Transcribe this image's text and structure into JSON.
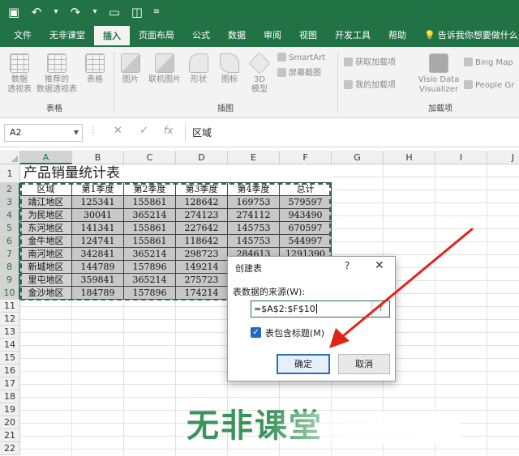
{
  "titlebar": {
    "icons": [
      "save-icon",
      "undo-icon",
      "redo-icon",
      "new-file-icon",
      "open-file-icon",
      "customize-icon"
    ]
  },
  "tabs": [
    "文件",
    "无非课堂",
    "插入",
    "页面布局",
    "公式",
    "数据",
    "审阅",
    "视图",
    "开发工具",
    "帮助"
  ],
  "tell_me": "告诉我你想要做什么",
  "ribbon": {
    "pivot": "数据\n透视表",
    "recommended_pivot": "推荐的\n数据透视表",
    "table": "表格",
    "pictures": "图片",
    "online_pictures": "联机图片",
    "shapes": "形状",
    "icons": "图标",
    "model3d": "3D\n模型",
    "smartart": "SmartArt",
    "screenshot": "屏幕截图",
    "get_addins": "获取加载项",
    "my_addins": "我的加载项",
    "visio": "Visio Data\nVisualizer",
    "bing_maps": "Bing Map",
    "people_graph": "People Gr",
    "group_tables": "表格",
    "group_illustrations": "插图",
    "group_addins": "加载项"
  },
  "formula_bar": {
    "name_box": "A2",
    "content": "区域"
  },
  "columns": [
    "A",
    "B",
    "C",
    "D",
    "E",
    "F",
    "G",
    "H",
    "I",
    "J"
  ],
  "rows": [
    "1",
    "2",
    "3",
    "4",
    "5",
    "6",
    "7",
    "8",
    "9",
    "10",
    "11",
    "12",
    "13",
    "14",
    "15",
    "16",
    "17",
    "18",
    "19",
    "20",
    "21",
    "22"
  ],
  "sheet": {
    "title": "产品销量统计表",
    "headers": [
      "区域",
      "第1季度",
      "第2季度",
      "第3季度",
      "第4季度",
      "总计"
    ],
    "data": [
      [
        "靖江地区",
        "125341",
        "155861",
        "128642",
        "169753",
        "579597"
      ],
      [
        "为民地区",
        "30041",
        "365214",
        "274123",
        "274112",
        "943490"
      ],
      [
        "东河地区",
        "141341",
        "155861",
        "227642",
        "145753",
        "670597"
      ],
      [
        "金牛地区",
        "124741",
        "155861",
        "118642",
        "145753",
        "544997"
      ],
      [
        "南河地区",
        "342841",
        "365214",
        "298723",
        "284613",
        "1291390"
      ],
      [
        "新城地区",
        "144789",
        "157896",
        "149214",
        "",
        ""
      ],
      [
        "里屯地区",
        "359841",
        "365214",
        "275723",
        "",
        ""
      ],
      [
        "金沙地区",
        "184789",
        "157896",
        "174214",
        "",
        ""
      ]
    ]
  },
  "dialog": {
    "title": "创建表",
    "help": "?",
    "close": "✕",
    "source_label": "表数据的来源(W):",
    "source_value": "=$A$2:$F$10",
    "has_headers_label": "表包含标题(M)",
    "has_headers_checked": true,
    "ok": "确定",
    "cancel": "取消"
  },
  "watermark": "无非课堂",
  "colors": {
    "excel_green": "#217346",
    "arrow_red": "#e2231a",
    "ok_border": "#2a6fb3",
    "watermark": "#2a8b4e"
  }
}
